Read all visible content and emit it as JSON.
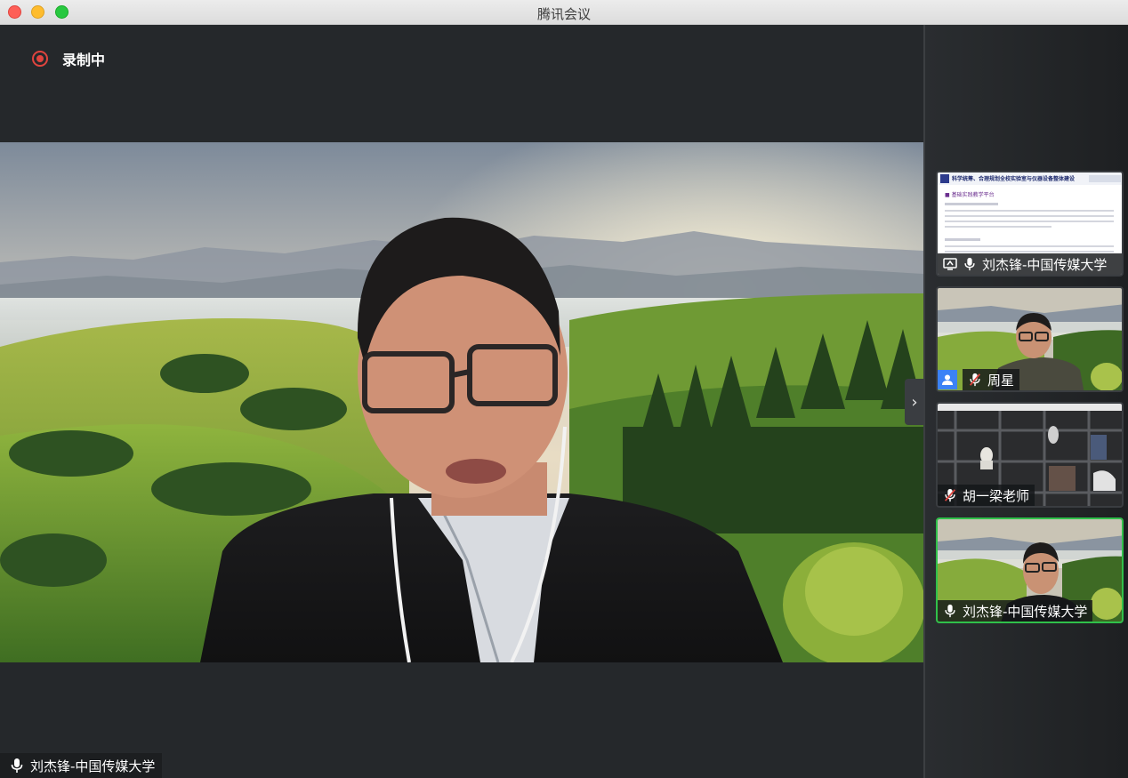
{
  "window": {
    "title": "腾讯会议"
  },
  "recording": {
    "label": "录制中"
  },
  "main_speaker": {
    "name": "刘杰锋-中国传媒大学"
  },
  "sidebar": {
    "tiles": [
      {
        "name": "刘杰锋-中国传媒大学",
        "type": "screen-share",
        "mic": "on",
        "slide": {
          "title": "科学统筹、合理规划全校实验室与仪器设备整体建设",
          "heading": "■ 基础实践教学平台"
        }
      },
      {
        "name": "周星",
        "type": "camera",
        "mic": "muted",
        "icon": "user-icon"
      },
      {
        "name": "胡一梁老师",
        "type": "camera",
        "mic": "muted"
      },
      {
        "name": "刘杰锋-中国传媒大学",
        "type": "camera",
        "mic": "on",
        "active": true
      }
    ]
  },
  "colors": {
    "active_border": "#30c04a",
    "record_red": "#e0443e",
    "bg": "#25282b"
  }
}
